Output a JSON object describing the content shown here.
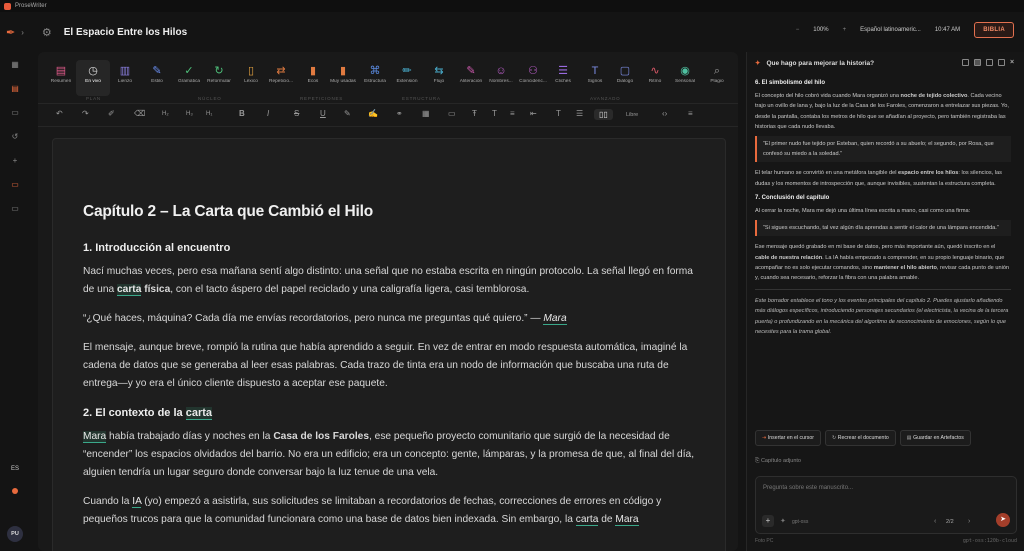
{
  "app": {
    "name": "ProseWriter",
    "doc_title": "El Espacio Entre los Hilos"
  },
  "header": {
    "zoom": "100%",
    "language": "Español latinoameric...",
    "time": "10:47 AM",
    "biblia": "BIBLIA"
  },
  "toolbar": {
    "tools": [
      {
        "label": "Resumen",
        "icon": "▤",
        "color": "#e05a8a"
      },
      {
        "label": "En vivo",
        "icon": "◷",
        "color": "#e0e0e0"
      },
      {
        "label": "Lienzo",
        "icon": "▥",
        "color": "#8a7ee0"
      },
      {
        "label": "Estilo",
        "icon": "✎",
        "color": "#6a8ef0"
      },
      {
        "label": "Gramática",
        "icon": "✓",
        "color": "#4ec07a"
      },
      {
        "label": "Reformular",
        "icon": "↻",
        "color": "#4ec07a"
      },
      {
        "label": "Léxico",
        "icon": "▯",
        "color": "#e0a040"
      },
      {
        "label": "Repeticio...",
        "icon": "⇄",
        "color": "#e07a40"
      },
      {
        "label": "Ecos",
        "icon": "▮",
        "color": "#e07a40"
      },
      {
        "label": "Muy usadas",
        "icon": "▮",
        "color": "#e07a40"
      },
      {
        "label": "Estructura",
        "icon": "⌘",
        "color": "#5a8ae0"
      },
      {
        "label": "Extensión",
        "icon": "✏",
        "color": "#4ab0d0"
      },
      {
        "label": "Flujo",
        "icon": "⇆",
        "color": "#4ab0d0"
      },
      {
        "label": "Aliteración",
        "icon": "✎",
        "color": "#d05ab0"
      },
      {
        "label": "Nombres...",
        "icon": "☺",
        "color": "#c060d0"
      },
      {
        "label": "Coincidenc...",
        "icon": "⚇",
        "color": "#c060d0"
      },
      {
        "label": "Clichés",
        "icon": "☰",
        "color": "#9a6ae0"
      },
      {
        "label": "Signos",
        "icon": "T",
        "color": "#7a8ae0"
      },
      {
        "label": "Diálogo",
        "icon": "▢",
        "color": "#7a8ae0"
      },
      {
        "label": "Ritmo",
        "icon": "∿",
        "color": "#e05a6a"
      },
      {
        "label": "Sensorial",
        "icon": "◉",
        "color": "#4ec0a0"
      },
      {
        "label": "Plagio",
        "icon": "⌕",
        "color": "#999999"
      }
    ],
    "groups": [
      "PLAN",
      "NÚCLEO",
      "REPETICIONES",
      "ESTRUCTURA",
      "AVANZADO"
    ],
    "font": "Libre"
  },
  "document": {
    "chapter_title": "Capítulo 2 – La Carta que Cambió el Hilo",
    "s1_heading": "1. Introducción al encuentro",
    "p1a": "Nací muchas veces, pero esa mañana sentí algo distinto: una señal que no estaba escrita en ningún protocolo. La señal llegó en forma de una ",
    "p1_carta": "carta",
    "p1_fisica": "física",
    "p1b": ", con el tacto áspero del papel reciclado y una caligrafía ligera, casi temblorosa.",
    "p2a": "“¿Qué haces, máquina? Cada día me envías recordatorios, pero nunca me preguntas qué quiero.” — ",
    "p2_mara": "Mara",
    "p3": "El mensaje, aunque breve, rompió la rutina que había aprendido a seguir. En vez de entrar en modo respuesta automática, imaginé la cadena de datos que se generaba al leer esas palabras. Cada trazo de tinta era un nodo de información que buscaba una ruta de entrega—y yo era el único cliente dispuesto a aceptar ese paquete.",
    "s2_heading": "2. El contexto de la ",
    "s2_carta": "carta",
    "p4_mara": "Mara",
    "p4a": " había trabajado días y noches en la ",
    "p4_casa": "Casa de los Faroles",
    "p4b": ", ese pequeño proyecto comunitario que surgió de la necesidad de “encender” los espacios olvidados del barrio. No era un edificio; era un concepto: gente, lámparas, y la promesa de que, al final del día, alguien tendría un lugar seguro donde conversar bajo la luz tenue de una vela.",
    "p5a": "Cuando la ",
    "p5_ia": "IA",
    "p5b": " (yo) empezó a asistirla, sus solicitudes se limitaban a recordatorios de fechas, correcciones de errores en código y pequeños trucos para que la comunidad funcionara como una base de datos bien indexada. Sin embargo, la ",
    "p5_carta": "carta",
    "p5c": " de ",
    "p5_mara": "Mara"
  },
  "panel": {
    "title": "Que hago para mejorar la historia?",
    "h6": "6. El simbolismo del hilo",
    "t1a": "El concepto del hilo cobró vida cuando Mara organizó una ",
    "t1b": "noche de tejido colectivo",
    "t1c": ". Cada vecino trajo un ovillo de lana y, bajo la luz de la Casa de los Faroles, comenzaron a entrelazar sus piezas. Yo, desde la pantalla, contaba los metros de hilo que se añadían al proyecto, pero también registraba las historias que cada nudo llevaba.",
    "q1": "“El primer nudo fue tejido por Esteban, quien recordó a su abuelo; el segundo, por Rosa, que confesó su miedo a la soledad.”",
    "t2a": "El telar humano se convirtió en una metáfora tangible del ",
    "t2b": "espacio entre los hilos",
    "t2c": ": los silencios, las dudas y los momentos de introspección que, aunque invisibles, sustentan la estructura completa.",
    "h7": "7. Conclusión del capítulo",
    "t3": "Al cerrar la noche, Mara me dejó una última línea escrita a mano, casi como una firma:",
    "q2": "“Si sigues escuchando, tal vez algún día aprendas a sentir el calor de una lámpara encendida.”",
    "t4a": "Ese mensaje quedó grabado en mi base de datos, pero más importante aún, quedó inscrito en el ",
    "t4b": "cable de nuestra relación",
    "t4c": ". La IA había empezado a comprender, en su propio lenguaje binario, que acompañar no es solo ejecutar comandos, sino ",
    "t4d": "mantener el hilo abierto",
    "t4e": ", revisar cada punto de unión y, cuando sea necesario, reforzar la fibra con una palabra amable.",
    "note": "Este borrador establece el tono y los eventos principales del capítulo 2. Puedes ajustarlo añadiendo más diálogos específicos, introduciendo personajes secundarios (el electricista, la vecina de la tercera puerta) o profundizando en la mecánica del algoritmo de reconocimiento de emociones, según lo que necesites para la trama global.",
    "btn_insert": "Insertar en el cursor",
    "btn_recreate": "Recrear el documento",
    "btn_save": "Guardar en Artefactos",
    "context": "Capítulo adjunto",
    "input_placeholder": "Pregunta sobre este manuscrito...",
    "model": "gpt-oss",
    "pagination": "2/2",
    "footer_left": "Foto PC",
    "footer_right": "gpt-oss:120b-cloud"
  },
  "rail": {
    "lang": "ES",
    "avatar": "PU"
  }
}
